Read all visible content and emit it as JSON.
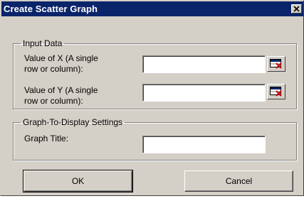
{
  "window": {
    "title": "Create Scatter Graph",
    "close_icon": "close-icon"
  },
  "input_data": {
    "legend": "Input Data",
    "x_label_line1": "Value of X (A single",
    "x_label_line2": "row or column):",
    "x_value": "",
    "y_label_line1": "Value of Y (A single",
    "y_label_line2": "row or column):",
    "y_value": "",
    "range_picker_icon": "range-select-icon"
  },
  "graph_settings": {
    "legend": "Graph-To-Display Settings",
    "title_label": "Graph Title:",
    "title_value": ""
  },
  "buttons": {
    "ok": "OK",
    "cancel": "Cancel"
  },
  "colors": {
    "titlebar": "#0a246a",
    "face": "#d4d0c8",
    "icon_accent": "#cc0000"
  }
}
